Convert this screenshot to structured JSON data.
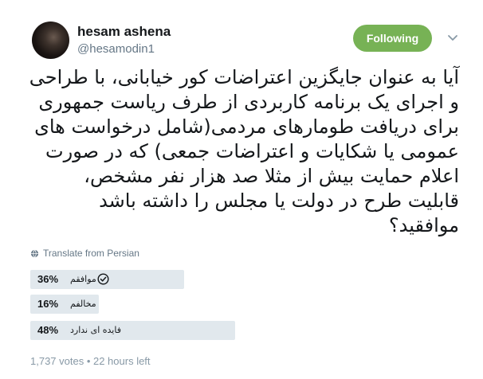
{
  "user": {
    "display_name": "hesam ashena",
    "handle": "@hesamodin1"
  },
  "follow_button": {
    "label": "Following",
    "color": "#77b255"
  },
  "tweet": {
    "text": "آیا به عنوان جایگزین اعتراضات کور خیابانی، با طراحی و اجرای یک برنامه کاربردی از طرف ریاست جمهوری برای دریافت طومارهای مردمی(شامل درخواست های عمومی یا شکایات و اعتراضات جمعی) که در صورت اعلام حمایت بیش از مثلا صد هزار نفر مشخص، قابلیت طرح در دولت یا مجلس را داشته باشد موافقید؟"
  },
  "translate": {
    "label": "Translate from Persian",
    "icon": "globe-icon"
  },
  "poll": {
    "options": [
      {
        "percent_label": "36%",
        "label": "موافقم",
        "share": 36,
        "selected": true
      },
      {
        "percent_label": "16%",
        "label": "مخالفم",
        "share": 16,
        "selected": false
      },
      {
        "percent_label": "48%",
        "label": "فایده ای ندارد",
        "share": 48,
        "selected": false
      }
    ],
    "footer": "1,737 votes • 22 hours left"
  }
}
